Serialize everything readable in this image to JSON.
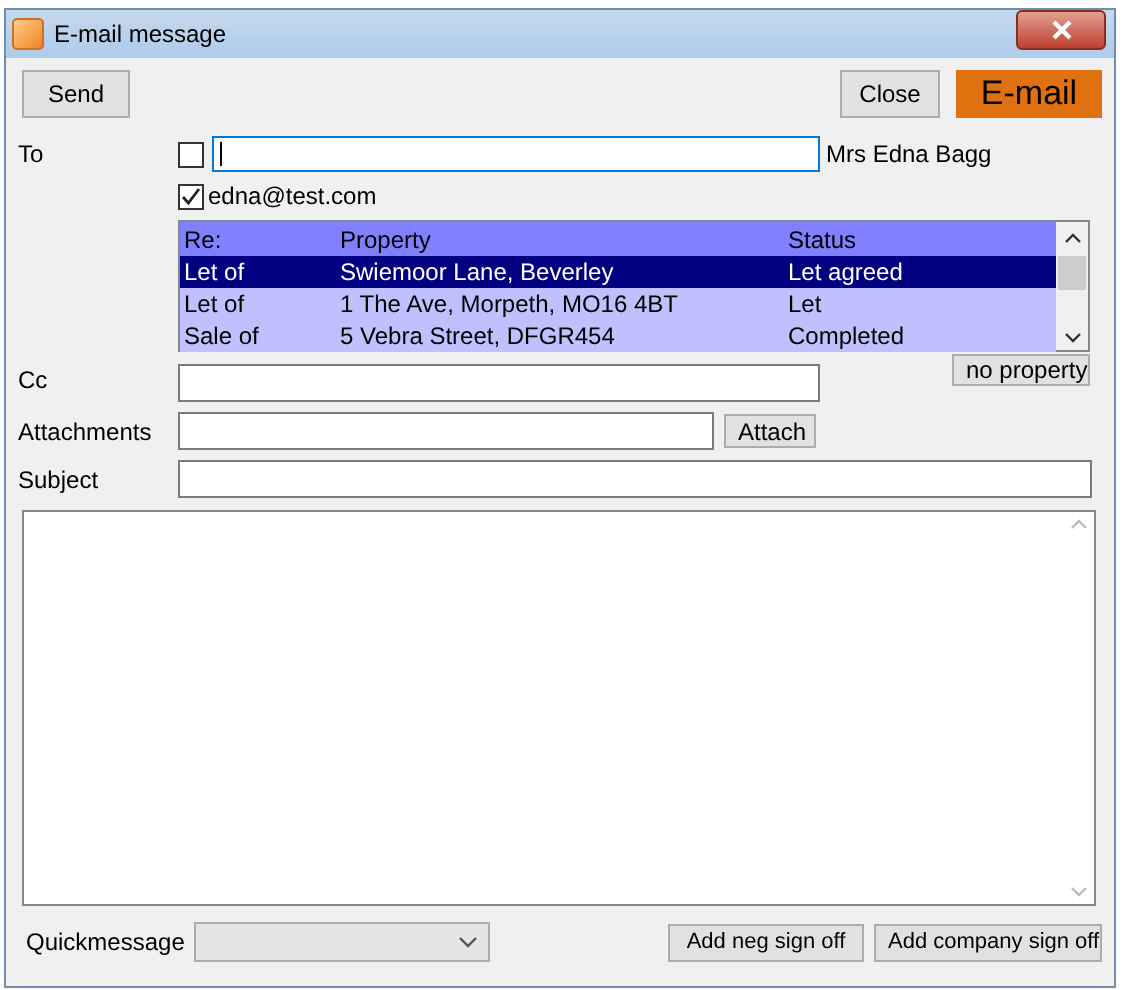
{
  "window": {
    "title": "E-mail message"
  },
  "toolbar": {
    "send": "Send",
    "close": "Close",
    "badge": "E-mail"
  },
  "to": {
    "label": "To",
    "checked": false,
    "focused": true,
    "contact_name": "Mrs Edna Bagg"
  },
  "emails": [
    {
      "address": "edna@test.com",
      "checked": true
    }
  ],
  "properties": {
    "columns": [
      "Re:",
      "Property",
      "Status"
    ],
    "rows": [
      {
        "cells": [
          "Let of",
          "Swiemoor Lane, Beverley",
          "Let agreed"
        ],
        "selected": true
      },
      {
        "cells": [
          "Let of",
          "1 The Ave, Morpeth, MO16 4BT",
          "Let"
        ],
        "selected": false
      },
      {
        "cells": [
          "Sale of",
          "5 Vebra Street, DFGR454",
          "Completed"
        ],
        "selected": false
      }
    ]
  },
  "no_property_button": "no property",
  "cc": {
    "label": "Cc"
  },
  "attachments": {
    "label": "Attachments",
    "button": "Attach"
  },
  "subject": {
    "label": "Subject"
  },
  "footer": {
    "label": "Quickmessage",
    "disabled": true,
    "buttons": [
      "Add neg sign off",
      "Add company sign off"
    ]
  }
}
